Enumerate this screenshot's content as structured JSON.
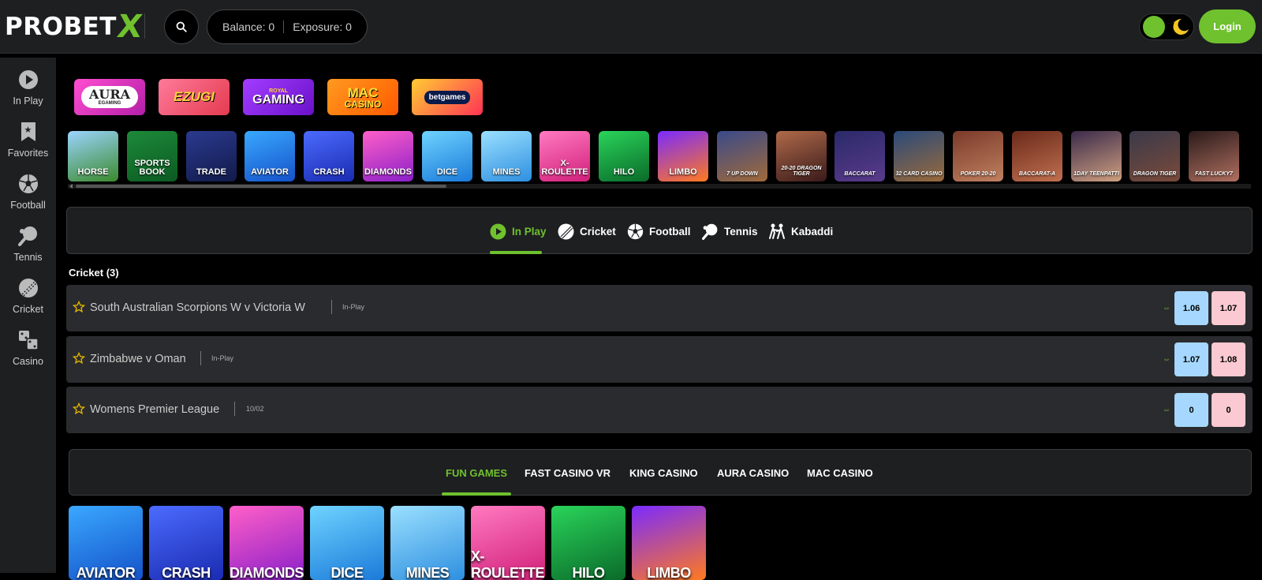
{
  "header": {
    "logo_text": "PROBET",
    "logo_accent": "X",
    "balance_label": "Balance: 0",
    "exposure_label": "Exposure: 0",
    "login_label": "Login",
    "accent_color": "#6fc12e"
  },
  "sidebar": {
    "items": [
      {
        "label": "In Play",
        "icon": "play-circle-icon"
      },
      {
        "label": "Favorites",
        "icon": "bookmark-star-icon"
      },
      {
        "label": "Football",
        "icon": "football-icon"
      },
      {
        "label": "Tennis",
        "icon": "tennis-racket-icon"
      },
      {
        "label": "Cricket",
        "icon": "cricket-ball-icon"
      },
      {
        "label": "Casino",
        "icon": "casino-dice-icon"
      }
    ]
  },
  "providers": [
    {
      "label": "AURA",
      "sub": "EGAMING"
    },
    {
      "label": "EZUGI"
    },
    {
      "label": "GAMING",
      "sub": "ROYAL"
    },
    {
      "label": "MAC",
      "sub": "CASINO"
    },
    {
      "label": "betgames"
    }
  ],
  "game_tiles": [
    {
      "label": "HORSE"
    },
    {
      "label": "SPORTS BOOK"
    },
    {
      "label": "TRADE"
    },
    {
      "label": "AVIATOR"
    },
    {
      "label": "CRASH"
    },
    {
      "label": "DIAMONDS"
    },
    {
      "label": "DICE"
    },
    {
      "label": "MINES"
    },
    {
      "label": "X-ROULETTE"
    },
    {
      "label": "HILO"
    },
    {
      "label": "LIMBO"
    },
    {
      "label": "7 UP DOWN"
    },
    {
      "label": "20-20 DRAGON TIGER"
    },
    {
      "label": "BACCARAT"
    },
    {
      "label": "32 CARD CASINO"
    },
    {
      "label": "POKER 20-20"
    },
    {
      "label": "BACCARAT-A"
    },
    {
      "label": "1DAY TEENPATTI"
    },
    {
      "label": "DRAGON TIGER"
    },
    {
      "label": "FAST LUCKY7"
    }
  ],
  "sport_tabs": [
    {
      "label": "In Play",
      "active": true
    },
    {
      "label": "Cricket"
    },
    {
      "label": "Football"
    },
    {
      "label": "Tennis"
    },
    {
      "label": "Kabaddi"
    }
  ],
  "section": {
    "title": "Cricket (3)"
  },
  "matches": [
    {
      "name": "South Australian Scorpions W v Victoria W",
      "status": "In-Play",
      "back": "1.06",
      "lay": "1.07"
    },
    {
      "name": "Zimbabwe v Oman",
      "status": "In-Play",
      "back": "1.07",
      "lay": "1.08"
    },
    {
      "name": "Womens Premier League",
      "status": "10/02",
      "back": "0",
      "lay": "0"
    }
  ],
  "casino_tabs": [
    {
      "label": "FUN GAMES",
      "active": true
    },
    {
      "label": "FAST CASINO VR"
    },
    {
      "label": "KING CASINO"
    },
    {
      "label": "AURA CASINO"
    },
    {
      "label": "MAC CASINO"
    }
  ],
  "fun_games": [
    {
      "label": "AVIATOR"
    },
    {
      "label": "CRASH"
    },
    {
      "label": "DIAMONDS"
    },
    {
      "label": "DICE"
    },
    {
      "label": "MINES"
    },
    {
      "label": "X-ROULETTE"
    },
    {
      "label": "HILO"
    },
    {
      "label": "LIMBO"
    }
  ]
}
